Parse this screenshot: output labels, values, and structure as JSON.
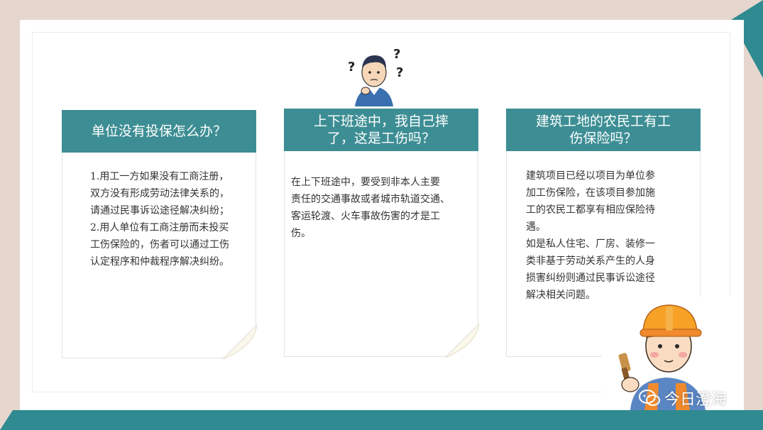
{
  "cards": [
    {
      "title": "单位没有投保怎么办？",
      "lines": [
        "1.用工一方如果没有工商注册，",
        "双方没有形成劳动法律关系的，",
        "请通过民事诉讼途径解决纠纷；",
        "2.用人单位有工商注册而未投买",
        "工伤保险的，伤者可以通过工伤",
        "认定程序和仲裁程序解决纠纷。"
      ]
    },
    {
      "title_lines": [
        "上下班途中，我自己摔",
        "了，这是工伤吗？"
      ],
      "lines": [
        "在上下班途中，要受到非本人主要",
        "责任的交通事故或者城市轨道交通、",
        "客运轮渡、火车事故伤害的才是工",
        "伤。"
      ]
    },
    {
      "title_lines": [
        "建筑工地的农民工有工",
        "伤保险吗？"
      ],
      "lines": [
        "建筑项目已经以项目为单位参",
        "加工伤保险，在该项目参加施",
        "工的农民工都享有相应保险待",
        "遇。",
        "如是私人住宅、厂房、装修一",
        "类非基于劳动关系产生的人身",
        "损害纠纷则通过民事诉讼途径",
        "解决相关问题。"
      ]
    }
  ],
  "watermark": {
    "text": "今日澄海",
    "icon": "wechat-icon"
  },
  "icons": {
    "thinking": "thinking-man-icon",
    "worker": "construction-worker-icon"
  },
  "colors": {
    "teal": "#3d8e94",
    "frame": "#e6d6cd",
    "dark_teal": "#2f7f86"
  }
}
